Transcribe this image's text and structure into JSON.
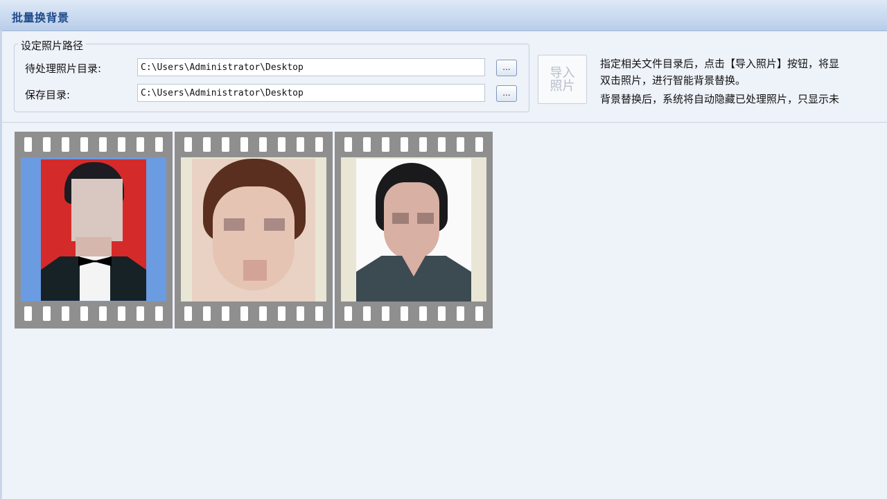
{
  "window": {
    "title": "批量换背景"
  },
  "path_group": {
    "legend": "设定照片路径",
    "source_label": "待处理照片目录:",
    "source_value": "C:\\Users\\Administrator\\Desktop",
    "save_label": "保存目录:",
    "save_value": "C:\\Users\\Administrator\\Desktop",
    "browse_label": "...",
    "browse_icon": "ellipsis-icon"
  },
  "import_button": {
    "line1": "导入",
    "line2": "照片"
  },
  "instructions": [
    "指定相关文件目录后，点击【导入照片】按钮，将显",
    "双击照片，进行智能背景替换。",
    "背景替换后，系统将自动隐藏已处理照片，只显示未"
  ],
  "thumbnails": [
    {
      "frame_bg": "#6b9be0",
      "photo_bg": "#d52a2a"
    },
    {
      "frame_bg": "#eae6d6",
      "photo_bg": "#e9d2c4"
    },
    {
      "frame_bg": "#eae6d6",
      "photo_bg": "#fafafa"
    }
  ]
}
